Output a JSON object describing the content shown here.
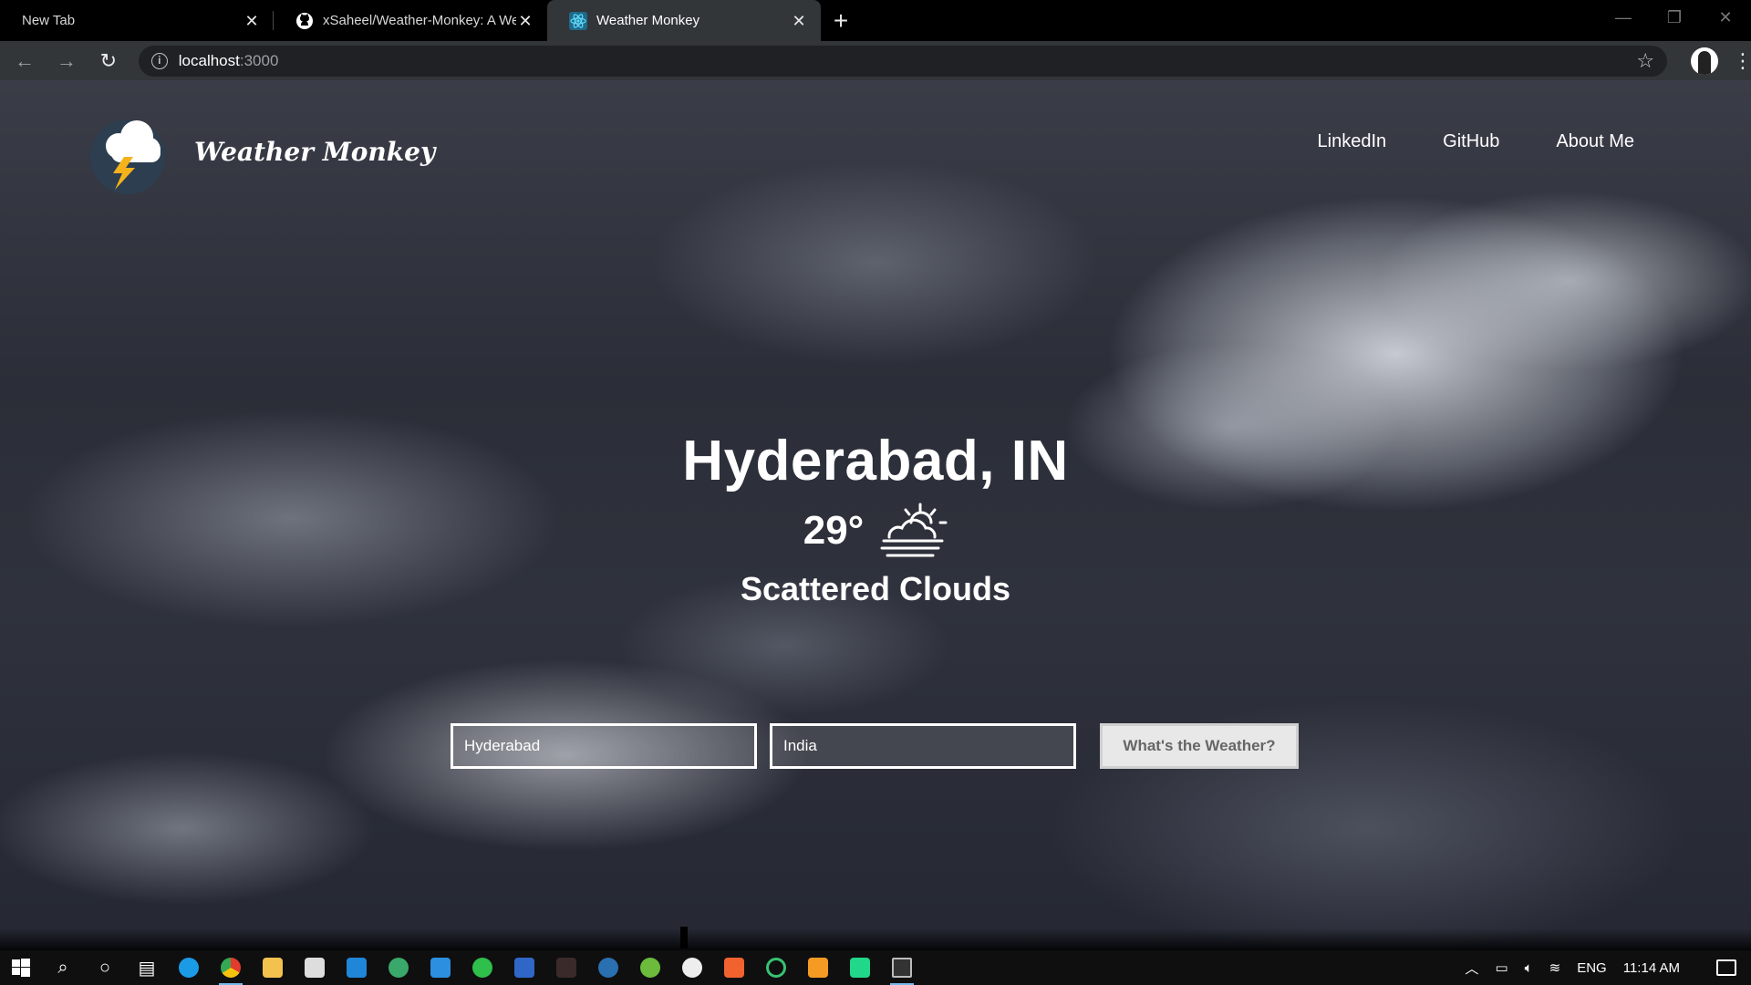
{
  "browser": {
    "tabs": [
      {
        "title": "New Tab",
        "favicon": "none",
        "active": false
      },
      {
        "title": "xSaheel/Weather-Monkey: A We",
        "favicon": "github-icon",
        "active": false
      },
      {
        "title": "Weather Monkey",
        "favicon": "react-icon",
        "active": true
      }
    ],
    "url_host": "localhost",
    "url_port": ":3000"
  },
  "app": {
    "brand": "Weather Monkey",
    "nav": [
      "LinkedIn",
      "GitHub",
      "About Me"
    ],
    "location": "Hyderabad, IN",
    "temperature": "29°",
    "weather_icon": "partly-cloudy-sun-icon",
    "description": "Scattered Clouds",
    "form": {
      "city_value": "Hyderabad",
      "country_value": "India",
      "submit_label": "What's the Weather?"
    }
  },
  "taskbar": {
    "language": "ENG",
    "time": "11:14 AM",
    "icons": [
      "windows-start-icon",
      "search-icon",
      "cortana-icon",
      "task-view-icon",
      "edge-icon",
      "chrome-icon",
      "file-explorer-icon",
      "store-icon",
      "mail-icon",
      "gitkraken-icon",
      "vscode-icon",
      "whatsapp-icon",
      "snipping-icon",
      "game-icon",
      "steam-icon",
      "utorrent-icon",
      "unity-icon",
      "brave-icon",
      "refresh-icon",
      "sublime-icon",
      "pycharm-icon",
      "terminal-icon"
    ]
  },
  "colors": {
    "accent_text": "#ffffff",
    "tab_active": "#323639",
    "button_bg": "#e8e8e8"
  }
}
